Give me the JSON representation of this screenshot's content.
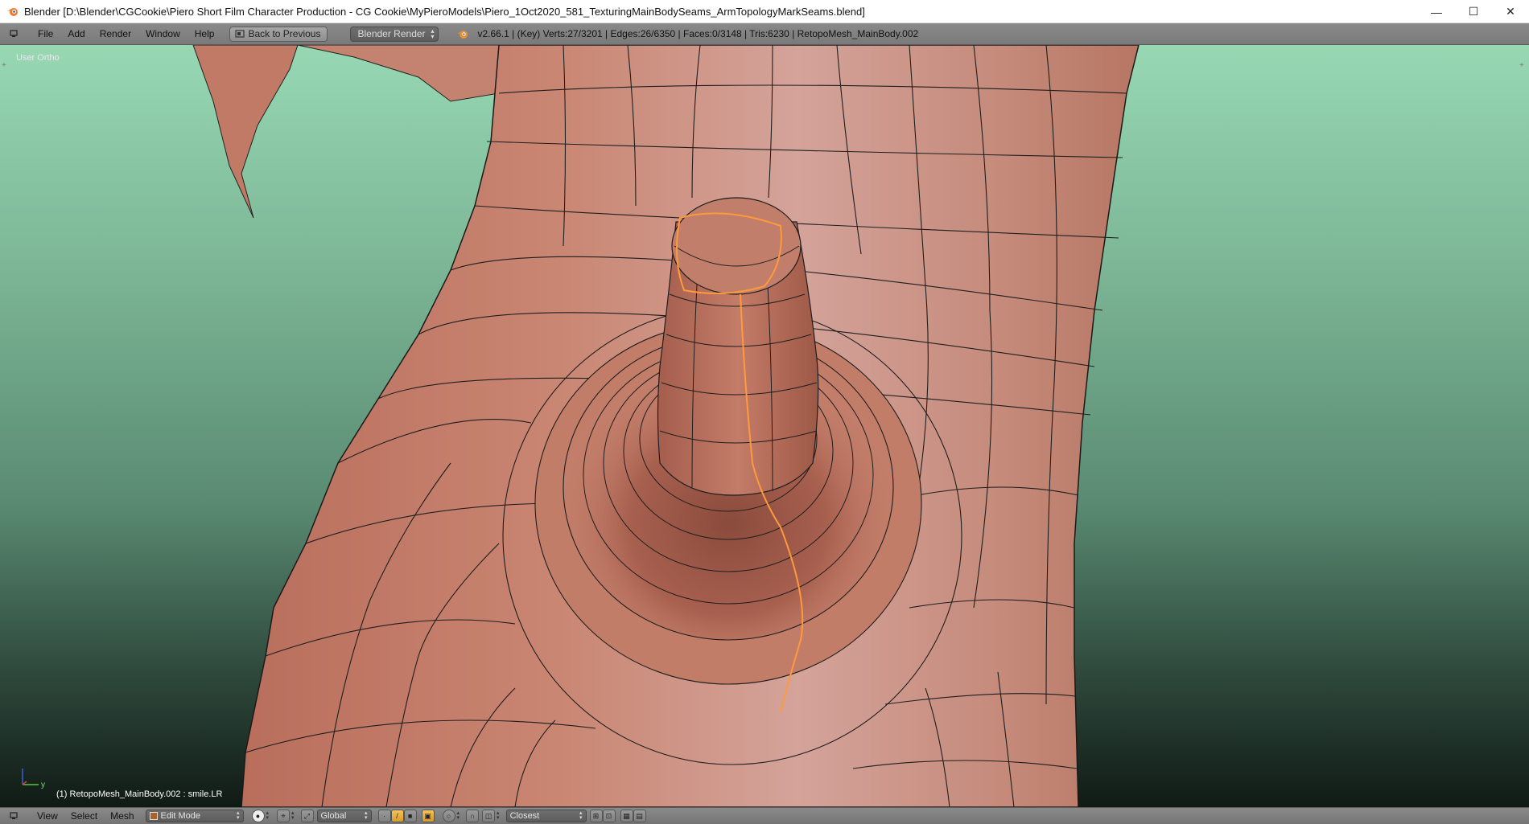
{
  "window": {
    "title": "Blender [D:\\Blender\\CGCookie\\Piero Short Film Character Production - CG Cookie\\MyPieroModels\\Piero_1Oct2020_581_TexturingMainBodySeams_ArmTopologyMarkSeams.blend]",
    "minimize_glyph": "—",
    "maximize_glyph": "☐",
    "close_glyph": "✕"
  },
  "info_header": {
    "menus": [
      "File",
      "Add",
      "Render",
      "Window",
      "Help"
    ],
    "back_button": "Back to Previous",
    "render_engine": "Blender Render",
    "stats": "v2.66.1 | (Key) Verts:27/3201 | Edges:26/6350 | Faces:0/3148 | Tris:6230 | RetopoMesh_MainBody.002"
  },
  "viewport": {
    "view_label": "User Ortho",
    "object_label": "(1) RetopoMesh_MainBody.002 : smile.LR",
    "axis_y": "y",
    "seam_color": "#ff9a3c",
    "mesh_color": "#c98672",
    "background_top": "#97d8b3"
  },
  "view_header": {
    "menus": [
      "View",
      "Select",
      "Mesh"
    ],
    "mode": "Edit Mode",
    "orientation": "Global",
    "snap_target": "Closest"
  }
}
